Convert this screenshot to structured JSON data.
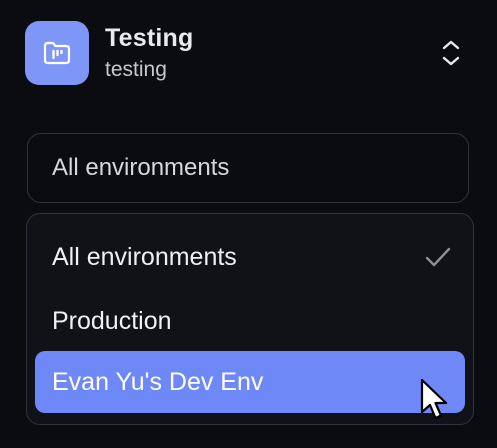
{
  "project": {
    "title": "Testing",
    "subtitle": "testing",
    "icon": "folder-chart-icon",
    "accent_color": "#7f96f9"
  },
  "environment_select": {
    "value": "All environments",
    "icon": "chevron-up-down-icon"
  },
  "environment_menu": {
    "items": [
      {
        "label": "All environments",
        "selected": true
      },
      {
        "label": "Production",
        "selected": false
      },
      {
        "label": "Evan Yu's Dev Env",
        "selected": false,
        "highlighted": true
      }
    ],
    "highlight_color": "#6f88f7",
    "check_icon": "checkmark-icon"
  },
  "pointer": {
    "icon": "mouse-cursor-icon"
  }
}
